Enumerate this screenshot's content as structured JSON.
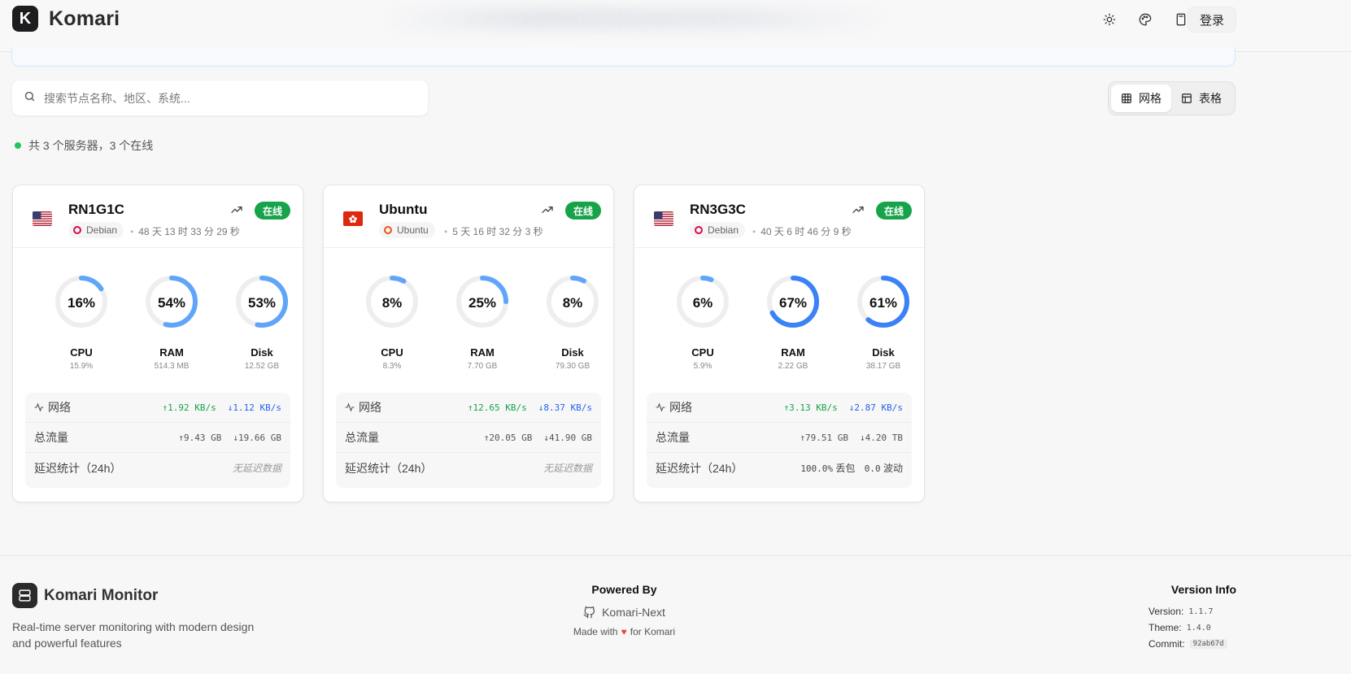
{
  "header": {
    "brand_letter": "K",
    "brand_name": "Komari",
    "icons": [
      "sun-icon",
      "palette-icon",
      "calculator-icon",
      "translate-icon"
    ],
    "login_label": "登录"
  },
  "search": {
    "placeholder": "搜索节点名称、地区、系统..."
  },
  "view_toggle": {
    "grid_label": "网格",
    "table_label": "表格",
    "active": "grid"
  },
  "summary": "共 3 个服务器，3 个在线",
  "servers": [
    {
      "name": "RN1G1C",
      "flag": "us",
      "os": "Debian",
      "uptime": "48 天 13 时 33 分 29 秒",
      "status": "在线",
      "cpu": {
        "pct": "16%",
        "value": 0.159,
        "label": "CPU",
        "sub": "15.9%"
      },
      "ram": {
        "pct": "54%",
        "value": 0.54,
        "label": "RAM",
        "sub": "514.3 MB"
      },
      "disk": {
        "pct": "53%",
        "value": 0.53,
        "label": "Disk",
        "sub": "12.52 GB"
      },
      "net_label": "网络",
      "net_up": "1.92 KB/s",
      "net_down": "1.12 KB/s",
      "traffic_label": "总流量",
      "traffic_up": "9.43 GB",
      "traffic_down": "19.66 GB",
      "latency_label": "延迟统计（24h）",
      "latency_text": "无延迟数据"
    },
    {
      "name": "Ubuntu",
      "flag": "hk",
      "os": "Ubuntu",
      "uptime": "5 天 16 时 32 分 3 秒",
      "status": "在线",
      "cpu": {
        "pct": "8%",
        "value": 0.083,
        "label": "CPU",
        "sub": "8.3%"
      },
      "ram": {
        "pct": "25%",
        "value": 0.25,
        "label": "RAM",
        "sub": "7.70 GB"
      },
      "disk": {
        "pct": "8%",
        "value": 0.08,
        "label": "Disk",
        "sub": "79.30 GB"
      },
      "net_label": "网络",
      "net_up": "12.65 KB/s",
      "net_down": "8.37 KB/s",
      "traffic_label": "总流量",
      "traffic_up": "20.05 GB",
      "traffic_down": "41.90 GB",
      "latency_label": "延迟统计（24h）",
      "latency_text": "无延迟数据"
    },
    {
      "name": "RN3G3C",
      "flag": "us",
      "os": "Debian",
      "uptime": "40 天 6 时 46 分 9 秒",
      "status": "在线",
      "cpu": {
        "pct": "6%",
        "value": 0.059,
        "label": "CPU",
        "sub": "5.9%"
      },
      "ram": {
        "pct": "67%",
        "value": 0.67,
        "label": "RAM",
        "sub": "2.22 GB"
      },
      "disk": {
        "pct": "61%",
        "value": 0.61,
        "label": "Disk",
        "sub": "38.17 GB"
      },
      "net_label": "网络",
      "net_up": "3.13 KB/s",
      "net_down": "2.87 KB/s",
      "traffic_label": "总流量",
      "traffic_up": "79.51 GB",
      "traffic_down": "4.20 TB",
      "latency_label": "延迟统计（24h）",
      "latency_loss": "100.0%",
      "latency_loss_label": "丢包",
      "latency_jitter": "0.0",
      "latency_jitter_label": "波动"
    }
  ],
  "footer": {
    "brand": "Komari Monitor",
    "description": "Real-time server monitoring with modern design and powerful features",
    "powered_by": "Powered By",
    "link": "Komari-Next",
    "made_with_prefix": "Made with",
    "made_with_suffix": "for Komari",
    "version_title": "Version Info",
    "version_label": "Version:",
    "version": "1.1.7",
    "theme_label": "Theme:",
    "theme": "1.4.0",
    "commit_label": "Commit:",
    "commit": "92ab67d"
  },
  "colors": {
    "online": "#16a34a",
    "up": "#16a34a",
    "down": "#2563eb",
    "gauge_light": "#60a5fa",
    "gauge_dark": "#3b82f6",
    "track": "#eeeeee"
  }
}
